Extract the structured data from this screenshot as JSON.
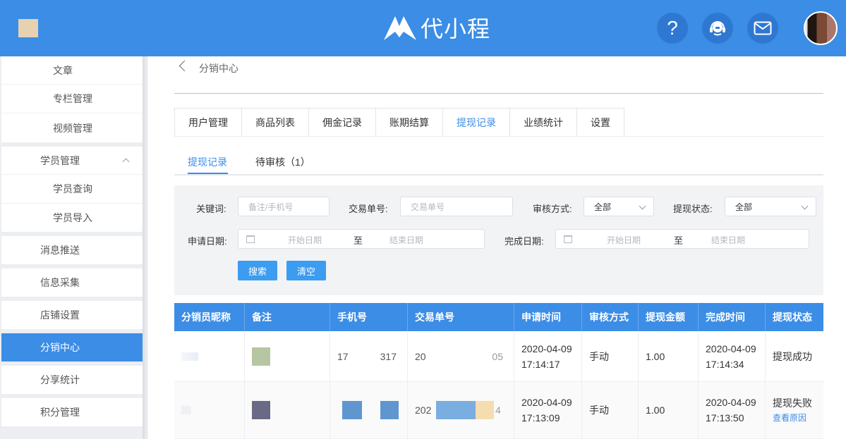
{
  "header": {
    "brand": "代小程",
    "icons": [
      "help-icon",
      "customer-service-icon",
      "mail-icon"
    ],
    "help_glyph": "?",
    "colors": {
      "header_bg": "#3b8de6",
      "accent": "#3b8de6"
    }
  },
  "sidebar": {
    "items": [
      {
        "label": "文章",
        "level": "sub"
      },
      {
        "label": "专栏管理",
        "level": "sub"
      },
      {
        "label": "视频管理",
        "level": "sub"
      },
      {
        "label": "学员管理",
        "level": "top"
      },
      {
        "label": "学员查询",
        "level": "sub"
      },
      {
        "label": "学员导入",
        "level": "sub"
      },
      {
        "label": "消息推送",
        "level": "top"
      },
      {
        "label": "信息采集",
        "level": "top"
      },
      {
        "label": "店铺设置",
        "level": "top"
      },
      {
        "label": "分销中心",
        "level": "top",
        "active": true
      },
      {
        "label": "分享统计",
        "level": "top"
      },
      {
        "label": "积分管理",
        "level": "top"
      }
    ]
  },
  "breadcrumb": {
    "title": "分销中心"
  },
  "tabs": [
    "用户管理",
    "商品列表",
    "佣金记录",
    "账期结算",
    "提现记录",
    "业绩统计",
    "设置"
  ],
  "active_tab": "提现记录",
  "subtabs": [
    "提现记录",
    "待审核（1）"
  ],
  "filter": {
    "keyword_label": "关键词:",
    "keyword_placeholder": "备注/手机号",
    "trade_no_label": "交易单号:",
    "trade_no_placeholder": "交易单号",
    "audit_label": "审核方式:",
    "audit_value": "全部",
    "status_label": "提现状态:",
    "status_value": "全部",
    "apply_date_label": "申请日期:",
    "finish_date_label": "完成日期:",
    "start_placeholder": "开始日期",
    "end_placeholder": "结束日期",
    "range_sep": "至",
    "search_button": "搜索",
    "clear_button": "清空"
  },
  "table": {
    "columns": [
      "分销员昵称",
      "备注",
      "手机号",
      "交易单号",
      "申请时间",
      "审核方式",
      "提现金额",
      "完成时间",
      "提现状态"
    ],
    "rows": [
      {
        "phone_start": "17",
        "phone_end": "317",
        "trade_start": "20",
        "trade_end": "05",
        "apply_date": "2020-04-09",
        "apply_time": "17:14:17",
        "audit": "手动",
        "amount": "1.00",
        "finish_date": "2020-04-09",
        "finish_time": "17:14:34",
        "status": "提现成功",
        "link": ""
      },
      {
        "phone_start": "",
        "phone_end": "",
        "trade_start": "202",
        "trade_end": "4",
        "apply_date": "2020-04-09",
        "apply_time": "17:13:09",
        "audit": "手动",
        "amount": "1.00",
        "finish_date": "2020-04-09",
        "finish_time": "17:13:50",
        "status": "提现失败",
        "link": "查看原因"
      }
    ]
  }
}
